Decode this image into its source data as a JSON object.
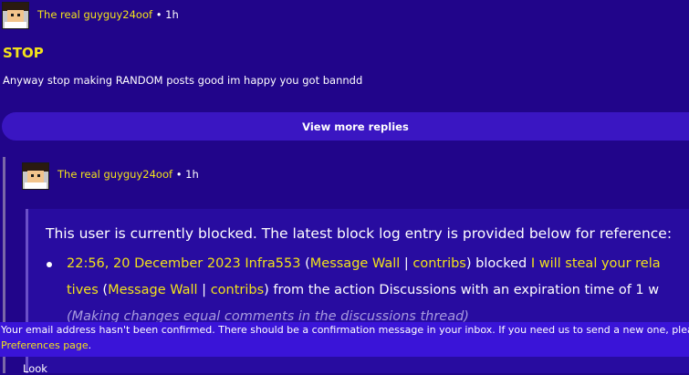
{
  "post": {
    "author": "The real guyguy24oof",
    "separator": "•",
    "time": "1h",
    "title": "STOP",
    "body": "Anyway stop making RANDOM posts good im happy you got banndd"
  },
  "view_more": {
    "label": "View more replies"
  },
  "reply": {
    "author": "The real guyguy24oof",
    "separator": "•",
    "time": "1h",
    "block_notice": {
      "heading": "This user is currently blocked. The latest block log entry is provided below for reference:",
      "entry": {
        "timestamp": "22:56, 20 December 2023",
        "blocker": "Infra553",
        "open_paren": " (",
        "blocker_wall": "Message Wall",
        "pipe": " | ",
        "blocker_contribs": "contribs",
        "close_blocked": ") blocked ",
        "target_part1": "I will steal your rela",
        "target_part2": "tives",
        "target_open": " (",
        "target_wall": "Message Wall",
        "target_pipe": " | ",
        "target_contribs": "contribs",
        "action_text": ") from the action Discussions with an expiration time of 1 w",
        "comment": "(Making changes equal comments in the discussions thread)"
      }
    },
    "body": "Look"
  },
  "banner": {
    "text": "Your email address hasn't been confirmed. There should be a confirmation message in your inbox. If you need us to send a new one, please",
    "link": "Preferences page",
    "tail": "."
  },
  "colors": {
    "background": "#21058a",
    "accent": "#f2e21a",
    "button": "#3a16c2",
    "banner": "#3a14d8"
  }
}
